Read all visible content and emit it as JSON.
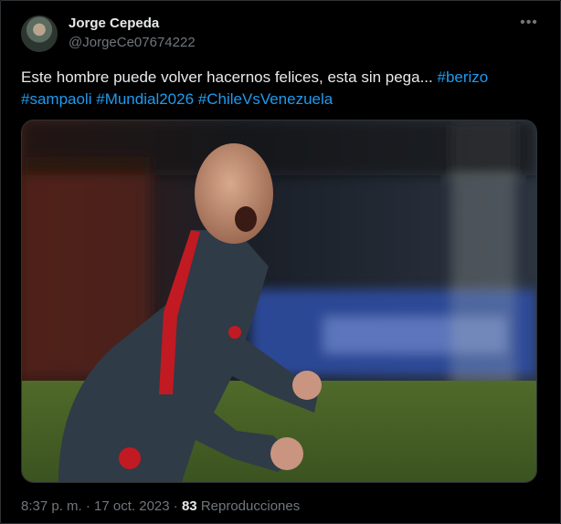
{
  "author": {
    "name": "Jorge Cepeda",
    "handle": "@JorgeCe07674222"
  },
  "tweet": {
    "text": "Este hombre puede volver hacernos felices, esta sin pega... ",
    "hashtags": [
      "#berizo",
      "#sampaoli",
      "#Mundial2026",
      "#ChileVsVenezuela"
    ]
  },
  "meta": {
    "time": "8:37 p. m.",
    "separator": "·",
    "date": "17 oct. 2023",
    "views_count": "83",
    "views_label": "Reproducciones"
  },
  "icons": {
    "more": "more-dots-icon",
    "avatar": "avatar"
  },
  "colors": {
    "background": "#000000",
    "text": "#e7e9ea",
    "secondary": "#71767b",
    "link": "#1d9bf0",
    "border": "#2f3336"
  }
}
